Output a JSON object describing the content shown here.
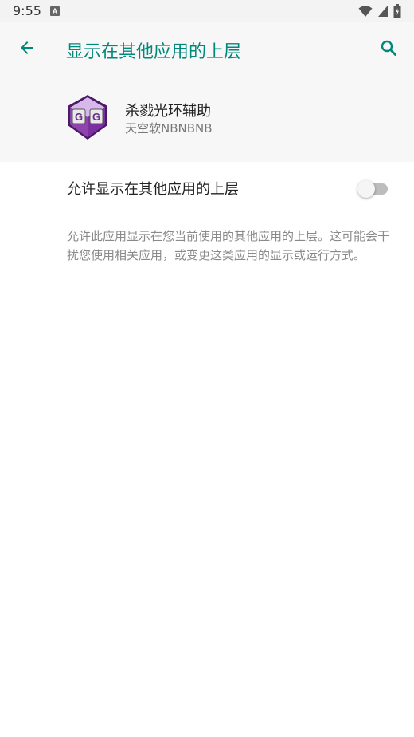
{
  "status_bar": {
    "time": "9:55",
    "notification_icon": "A"
  },
  "header": {
    "title": "显示在其他应用的上层",
    "back_icon": "arrow-left-icon",
    "search_icon": "search-icon"
  },
  "app": {
    "name": "杀戮光环辅助",
    "developer": "天空软NBNBNB",
    "icon_letters": "GG"
  },
  "setting": {
    "label": "允许显示在其他应用的上层",
    "enabled": false,
    "description": "允许此应用显示在您当前使用的其他应用的上层。这可能会干扰您使用相关应用，或变更这类应用的显示或运行方式。"
  },
  "colors": {
    "accent": "#00897b",
    "header_bg": "#f7f7f7",
    "icon_purple": "#7b2fa0"
  }
}
